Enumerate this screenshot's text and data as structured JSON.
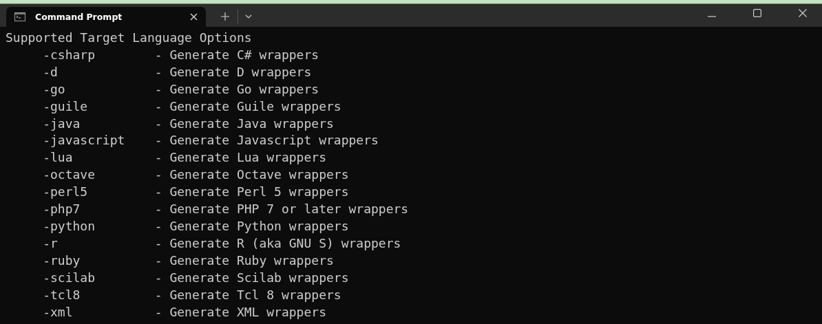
{
  "window": {
    "tab": {
      "title": "Command Prompt",
      "selected": true
    }
  },
  "terminal": {
    "heading": "Supported Target Language Options",
    "options": [
      {
        "flag": "-csharp",
        "description": "- Generate C# wrappers"
      },
      {
        "flag": "-d",
        "description": "- Generate D wrappers"
      },
      {
        "flag": "-go",
        "description": "- Generate Go wrappers"
      },
      {
        "flag": "-guile",
        "description": "- Generate Guile wrappers"
      },
      {
        "flag": "-java",
        "description": "- Generate Java wrappers"
      },
      {
        "flag": "-javascript",
        "description": "- Generate Javascript wrappers"
      },
      {
        "flag": "-lua",
        "description": "- Generate Lua wrappers"
      },
      {
        "flag": "-octave",
        "description": "- Generate Octave wrappers"
      },
      {
        "flag": "-perl5",
        "description": "- Generate Perl 5 wrappers"
      },
      {
        "flag": "-php7",
        "description": "- Generate PHP 7 or later wrappers"
      },
      {
        "flag": "-python",
        "description": "- Generate Python wrappers"
      },
      {
        "flag": "-r",
        "description": "- Generate R (aka GNU S) wrappers"
      },
      {
        "flag": "-ruby",
        "description": "- Generate Ruby wrappers"
      },
      {
        "flag": "-scilab",
        "description": "- Generate Scilab wrappers"
      },
      {
        "flag": "-tcl8",
        "description": "- Generate Tcl 8 wrappers"
      },
      {
        "flag": "-xml",
        "description": "- Generate XML wrappers"
      }
    ]
  }
}
